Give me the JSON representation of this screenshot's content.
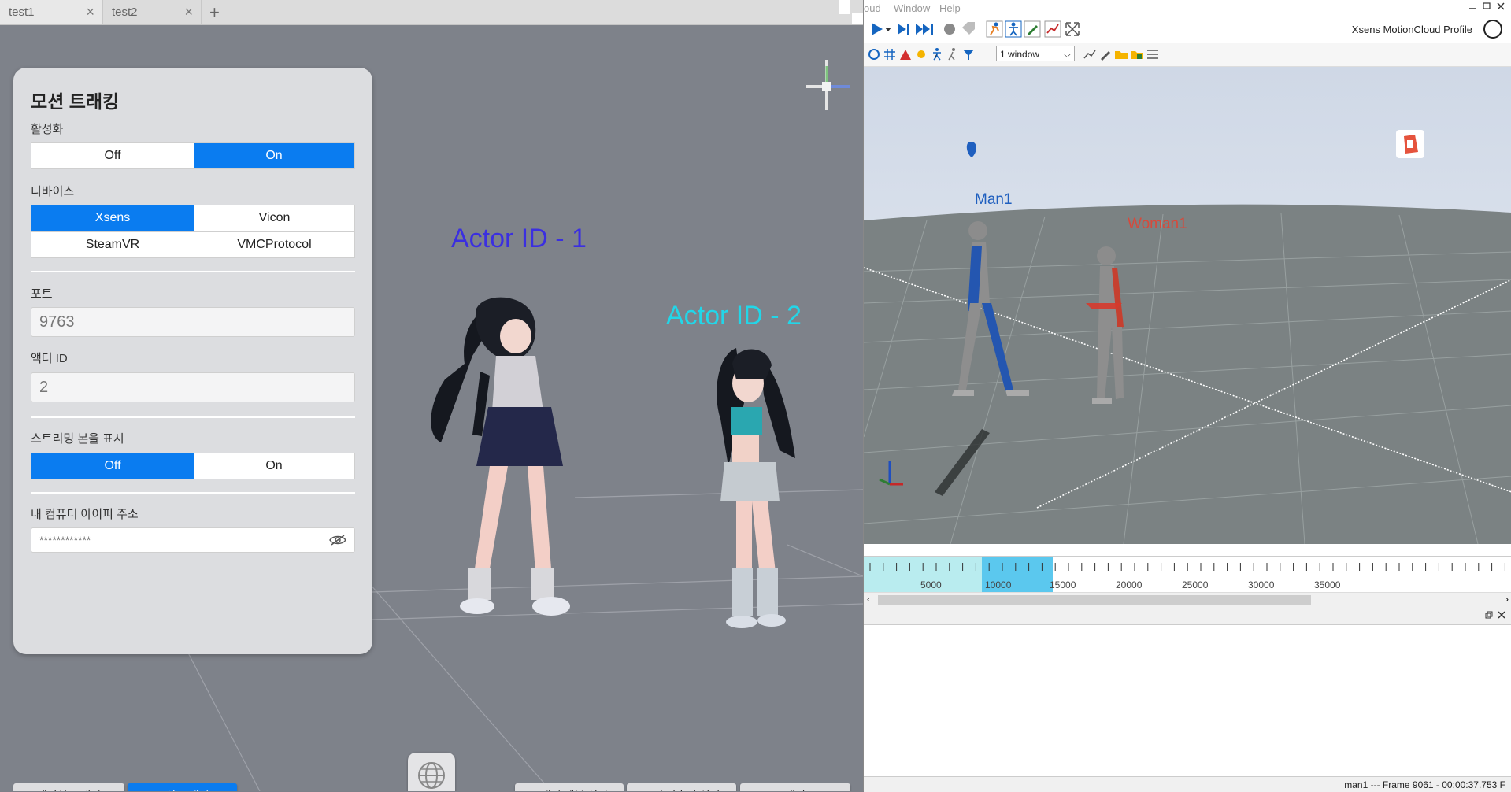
{
  "left_app": {
    "tabs": [
      {
        "label": "test1"
      },
      {
        "label": "test2"
      }
    ],
    "add_tab": "+",
    "close_glyph": "×",
    "panel": {
      "title": "모션 트래킹",
      "activation": {
        "label": "활성화",
        "options": [
          "Off",
          "On"
        ],
        "selected": "On"
      },
      "device": {
        "label": "디바이스",
        "options": [
          "Xsens",
          "Vicon",
          "SteamVR",
          "VMCProtocol"
        ],
        "selected": "Xsens"
      },
      "port": {
        "label": "포트",
        "value": "9763"
      },
      "actor_id": {
        "label": "액터 ID",
        "value": "2"
      },
      "streaming_bones": {
        "label": "스트리밍 본을 표시",
        "options": [
          "Off",
          "On"
        ],
        "selected": "Off"
      },
      "ip_address": {
        "label": "내 컴퓨터 아이피 주소",
        "value": "************"
      }
    },
    "scene_labels": {
      "actor1": "Actor ID - 1",
      "actor2": "Actor ID - 2"
    },
    "bottom_buttons": {
      "facial": "페이셜 트래킹",
      "motion": "모션 트래킹",
      "tracking_settings": "트래킹 세부 설정",
      "expression_shortcuts": "표정 단축키 설정",
      "actor": "액터"
    },
    "colors": {
      "accent": "#0a7cf0",
      "actor1": "#3b2fe0",
      "actor2": "#22d6e8"
    }
  },
  "right_app": {
    "menu": [
      "oud",
      "Window",
      "Help"
    ],
    "profile": "Xsens MotionCloud Profile",
    "window_select": "1 window",
    "labels": {
      "man": "Man1",
      "woman": "Woman1"
    },
    "timeline_ticks": [
      "5000",
      "10000",
      "15000",
      "20000",
      "25000",
      "30000",
      "35000"
    ],
    "status": "man1 --- Frame 9061 - 00:00:37.753 F",
    "colors": {
      "man": "#1f5fbf",
      "woman": "#d64a3c"
    }
  }
}
